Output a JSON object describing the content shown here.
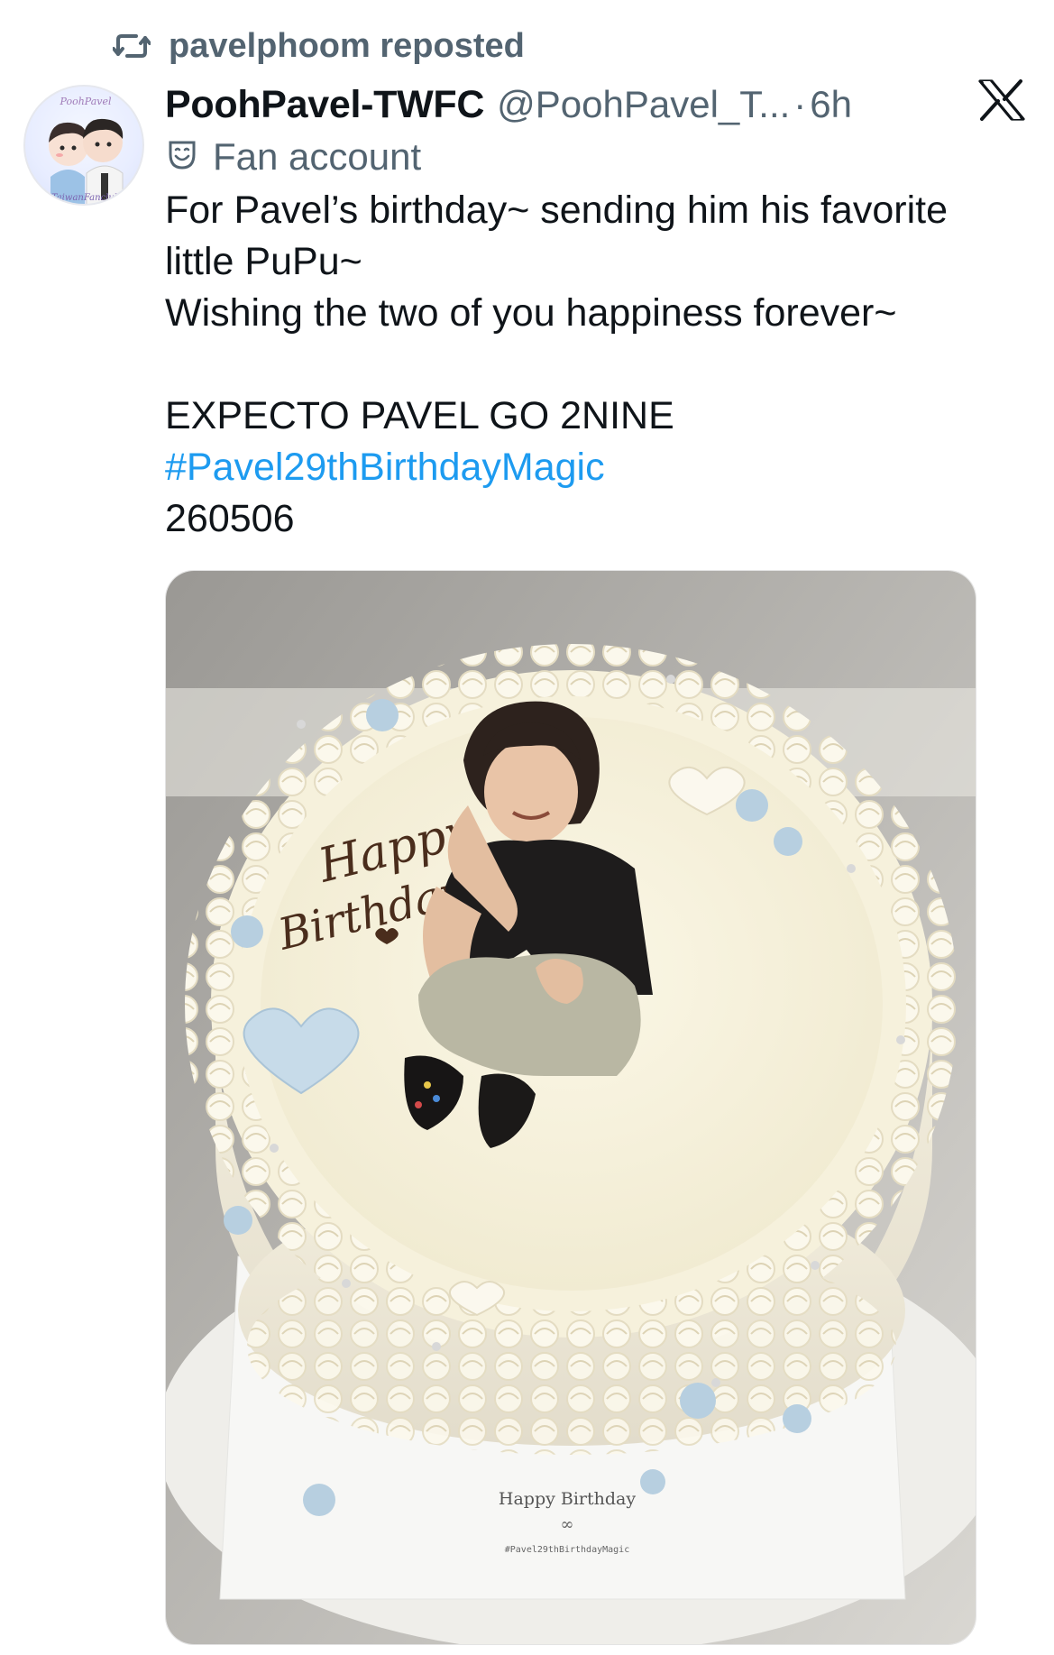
{
  "repost": {
    "label": "pavelphoom reposted",
    "icon": "repost-icon"
  },
  "author": {
    "avatar": "avatar",
    "display_name": "PoohPavel-TWFC",
    "handle": "@PoohPavel_T...",
    "separator": "·",
    "time": "6h",
    "badge_icon": "theater-mask-icon",
    "badge_label": "Fan account",
    "avatar_text_top": "PoohPavel",
    "avatar_text_bottom": "TaiwanFanclub"
  },
  "platform": {
    "logo_icon": "x-logo-icon"
  },
  "tweet": {
    "line1": "For Pavel’s birthday~ sending him his favorite",
    "line2": "little PuPu~",
    "line3": "Wishing the two of you happiness forever~",
    "line4": "EXPECTO PAVEL GO 2NINE",
    "hashtag": "#Pavel29thBirthdayMagic",
    "line5": "260506"
  },
  "media": {
    "cake_text_happy": "Happy",
    "cake_text_birthday": "Birthday",
    "board_text": "Happy Birthday",
    "board_hashtag": "#Pavel29thBirthdayMagic"
  },
  "colors": {
    "hashtag": "#1d9bf0",
    "secondary_text": "#536471",
    "primary_text": "#0f1419"
  }
}
